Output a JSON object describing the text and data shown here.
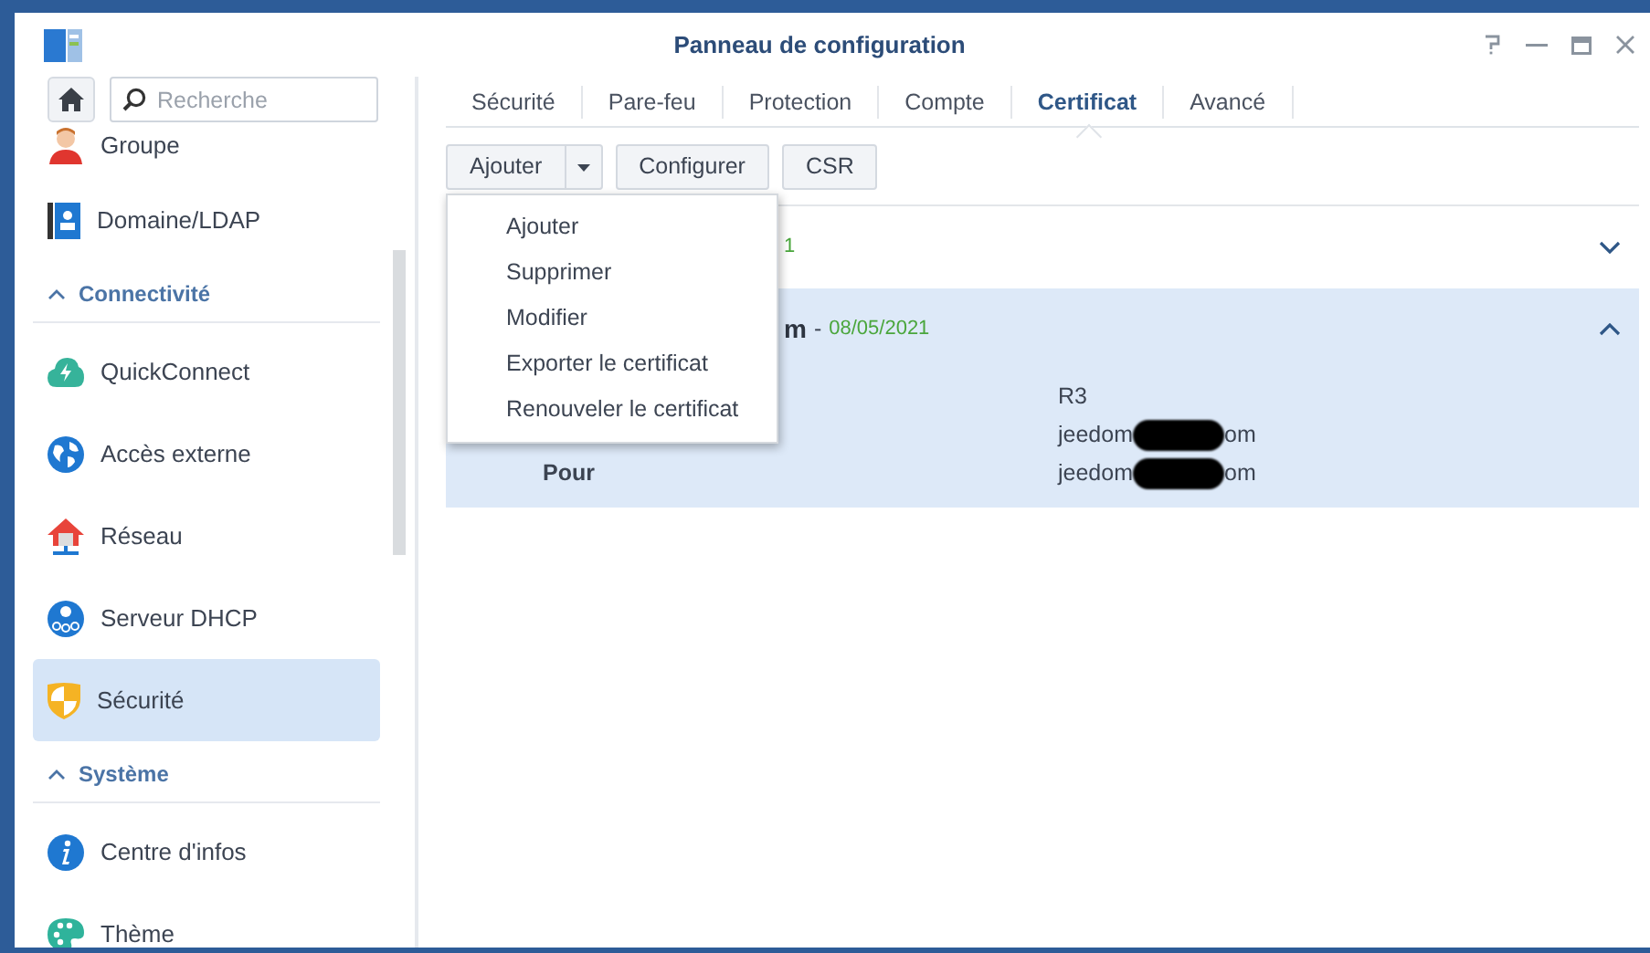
{
  "window": {
    "title": "Panneau de configuration"
  },
  "sidebar": {
    "search": {
      "placeholder": "Recherche"
    },
    "items": [
      {
        "kind": "item",
        "label": "Groupe",
        "selected": false
      },
      {
        "kind": "item",
        "label": "Domaine/LDAP",
        "selected": false
      },
      {
        "kind": "section",
        "label": "Connectivité",
        "expanded": true
      },
      {
        "kind": "item",
        "label": "QuickConnect",
        "selected": false
      },
      {
        "kind": "item",
        "label": "Accès externe",
        "selected": false
      },
      {
        "kind": "item",
        "label": "Réseau",
        "selected": false
      },
      {
        "kind": "item",
        "label": "Serveur DHCP",
        "selected": false
      },
      {
        "kind": "item",
        "label": "Sécurité",
        "selected": true
      },
      {
        "kind": "section",
        "label": "Système",
        "expanded": true
      },
      {
        "kind": "item",
        "label": "Centre d'infos",
        "selected": false
      },
      {
        "kind": "item",
        "label": "Thème",
        "selected": false
      }
    ]
  },
  "tabs": [
    {
      "label": "Sécurité",
      "selected": false
    },
    {
      "label": "Pare-feu",
      "selected": false
    },
    {
      "label": "Protection",
      "selected": false
    },
    {
      "label": "Compte",
      "selected": false
    },
    {
      "label": "Certificat",
      "selected": true
    },
    {
      "label": "Avancé",
      "selected": false
    }
  ],
  "toolbar": [
    {
      "kind": "split",
      "label": "Ajouter"
    },
    {
      "kind": "button",
      "label": "Configurer"
    },
    {
      "kind": "button",
      "label": "CSR"
    }
  ],
  "dropdown_menu": {
    "items": [
      "Ajouter",
      "Supprimer",
      "Modifier",
      "Exporter le certificat",
      "Renouveler le certificat"
    ]
  },
  "certificates": [
    {
      "date": "1",
      "expanded": false,
      "selected": false
    },
    {
      "title": "m",
      "separator": "-",
      "date": "08/05/2021",
      "expanded": true,
      "selected": true,
      "details": [
        {
          "value": "R3"
        },
        {
          "value": "jeedom",
          "value_end": "om",
          "redacted": true
        },
        {
          "label": "Pour",
          "value": "jeedom",
          "value_end": "om",
          "redacted": true
        }
      ]
    }
  ]
}
